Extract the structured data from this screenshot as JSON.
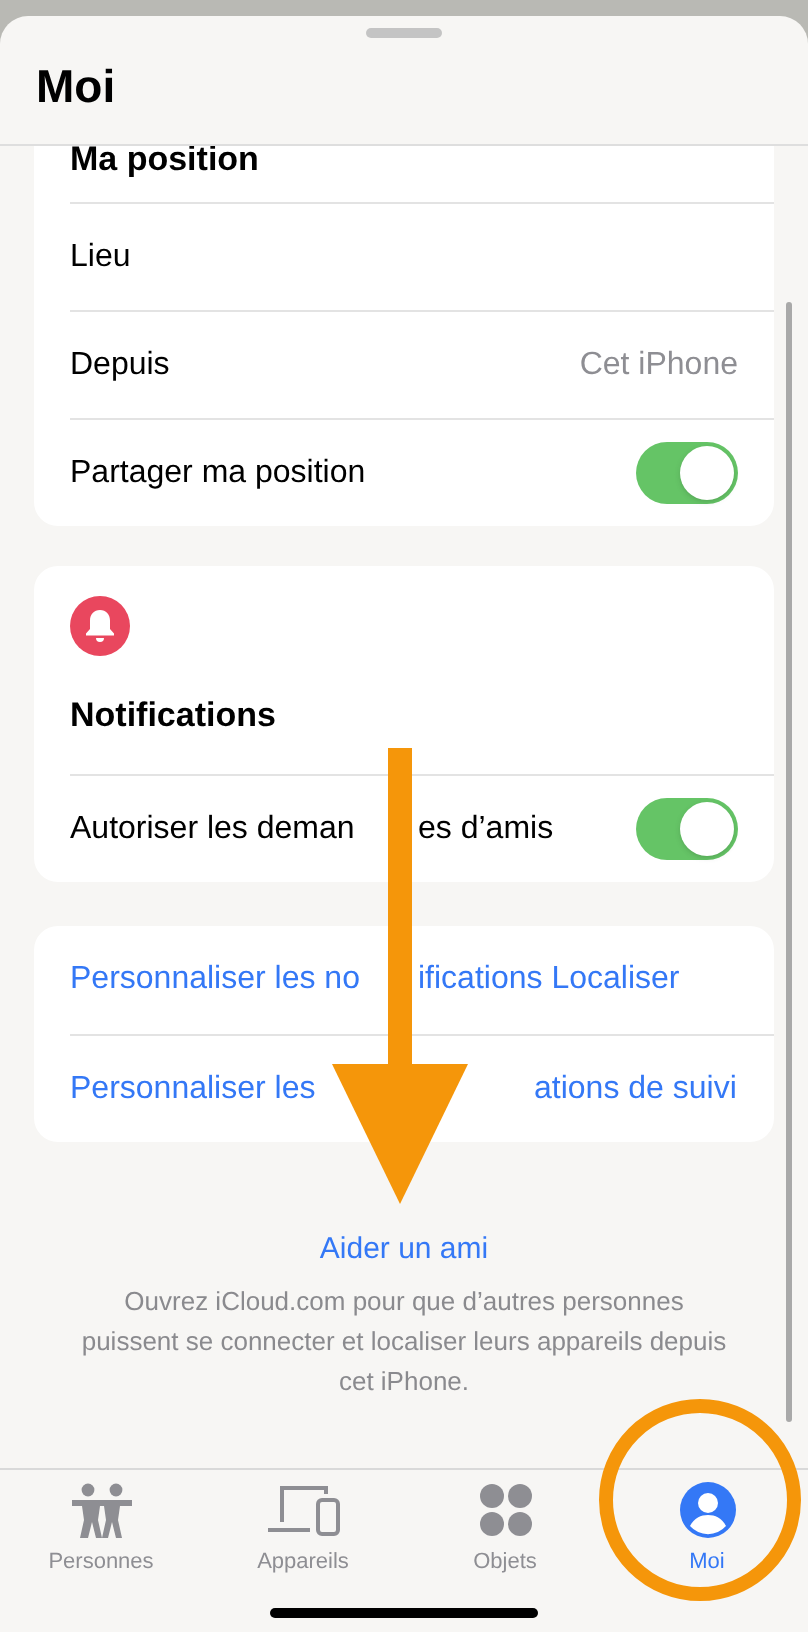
{
  "title": "Moi",
  "position_card": {
    "header": "Ma position",
    "rows": [
      {
        "kind": "plain",
        "label_parts": [
          "Lieu"
        ]
      },
      {
        "kind": "value",
        "label_parts": [
          "Depuis"
        ],
        "value": "Cet iPhone"
      },
      {
        "kind": "toggle",
        "label_parts": [
          "Partager ma position"
        ],
        "on": true
      }
    ]
  },
  "notifications_card": {
    "header": "Notifications",
    "rows": [
      {
        "kind": "toggle",
        "label_parts": [
          "Autoriser les deman",
          "es d’amis"
        ],
        "on": true
      }
    ]
  },
  "links": [
    {
      "label_parts": [
        "Personnaliser les no",
        "ifications Localiser"
      ]
    },
    {
      "label_parts": [
        "Personnaliser les",
        "ations de suivi"
      ]
    }
  ],
  "help": {
    "link": "Aider un ami",
    "text": "Ouvrez iCloud.com pour que d’autres personnes puissent se connecter et localiser leurs appareils depuis cet iPhone."
  },
  "tabs": [
    {
      "kind": "people",
      "label": "Personnes",
      "selected": false
    },
    {
      "kind": "devices",
      "label": "Appareils",
      "selected": false
    },
    {
      "kind": "items",
      "label": "Objets",
      "selected": false
    },
    {
      "kind": "me",
      "label": "Moi",
      "selected": true
    }
  ]
}
